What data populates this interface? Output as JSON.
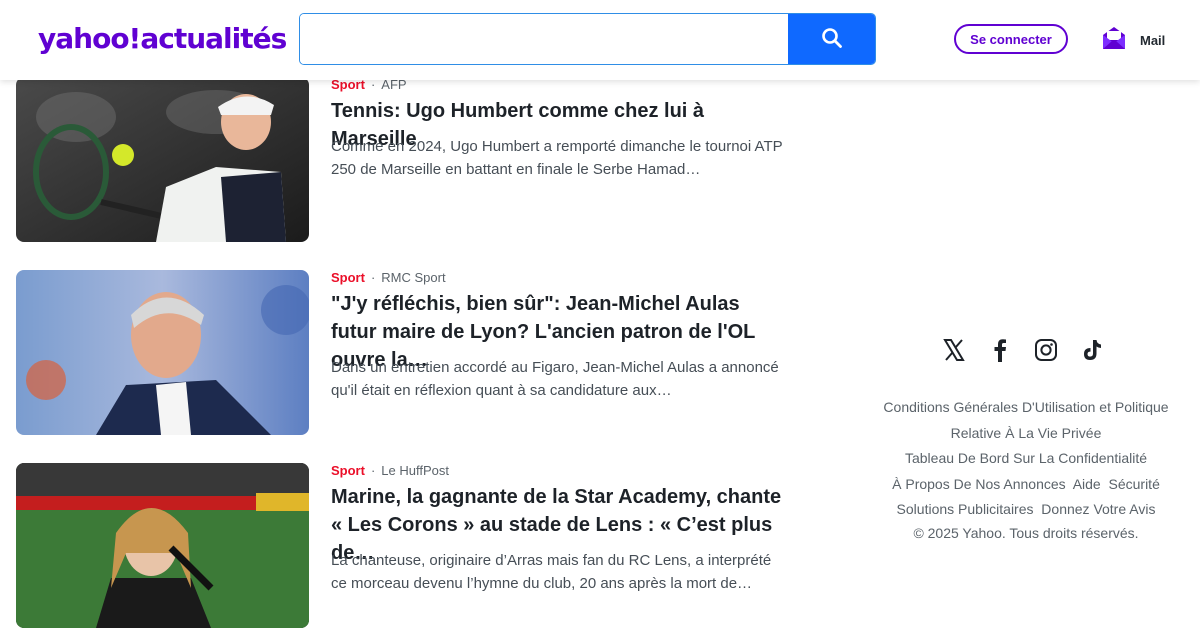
{
  "header": {
    "logo_text": "yahoo!actualités",
    "search": {
      "value": "",
      "placeholder": ""
    },
    "signin_label": "Se connecter",
    "mail_label": "Mail"
  },
  "articles": [
    {
      "category": "Sport",
      "source": "AFP",
      "title": "Tennis: Ugo Humbert comme chez lui à Marseille",
      "summary": "Comme en 2024, Ugo Humbert a remporté dimanche le tournoi ATP 250 de Marseille en battant en finale le Serbe Hamad…"
    },
    {
      "category": "Sport",
      "source": "RMC Sport",
      "title": "\"J'y réfléchis, bien sûr\": Jean-Michel Aulas futur maire de Lyon? L'ancien patron de l'OL ouvre la…",
      "summary": "Dans un entretien accordé au Figaro, Jean-Michel Aulas a annoncé qu'il était en réflexion quant à sa candidature aux…"
    },
    {
      "category": "Sport",
      "source": "Le HuffPost",
      "title": "Marine, la gagnante de la Star Academy, chante « Les Corons » au stade de Lens : « C’est plus de…",
      "summary": "La chanteuse, originaire d’Arras mais fan du RC Lens, a interprété ce morceau devenu l’hymne du club, 20 ans après la mort de…"
    }
  ],
  "social_icons": [
    "x-icon",
    "facebook-icon",
    "instagram-icon",
    "tiktok-icon"
  ],
  "footer": {
    "terms": "Conditions Générales D'Utilisation et Politique Relative À La Vie Privée",
    "privacy_dashboard": "Tableau De Bord Sur La Confidentialité",
    "about_ads": "À Propos De Nos Annonces",
    "help": "Aide",
    "security": "Sécurité",
    "ad_solutions": "Solutions Publicitaires",
    "feedback": "Donnez Votre Avis",
    "copyright": "© 2025 Yahoo. Tous droits réservés."
  },
  "colors": {
    "brand": "#6001d2",
    "search_button": "#0f69ff",
    "category": "#eb0f29"
  }
}
